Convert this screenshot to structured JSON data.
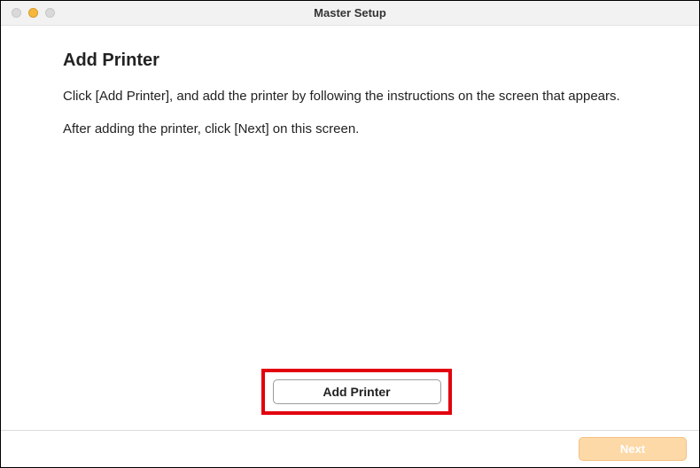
{
  "window": {
    "title": "Master Setup"
  },
  "main": {
    "heading": "Add Printer",
    "para1": "Click [Add Printer], and add the printer by following the instructions on the screen that appears.",
    "para2": "After adding the printer, click [Next] on this screen."
  },
  "buttons": {
    "add_printer": "Add Printer",
    "next": "Next"
  }
}
